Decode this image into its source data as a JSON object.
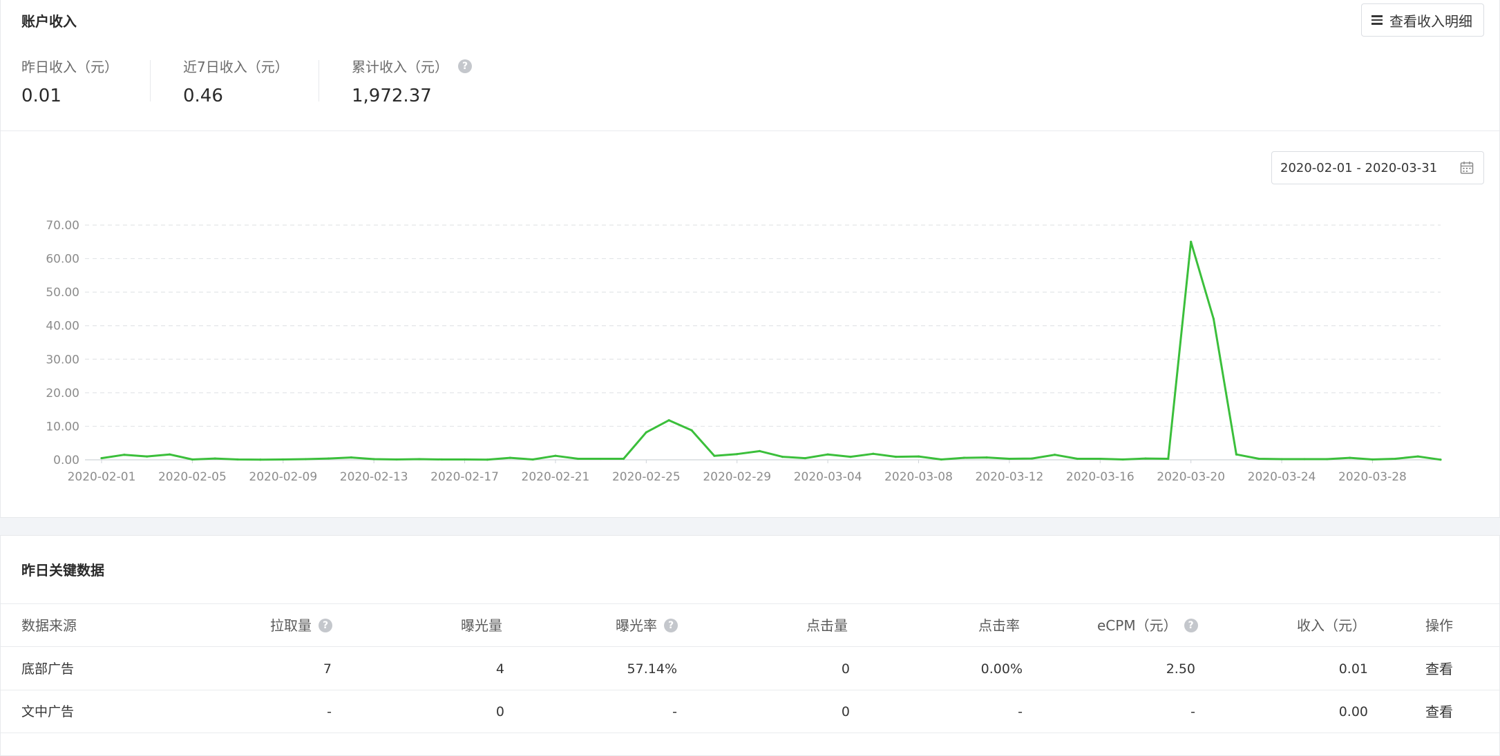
{
  "income": {
    "title": "账户收入",
    "detail_button": "查看收入明细",
    "stats": [
      {
        "label": "昨日收入（元）",
        "value": "0.01"
      },
      {
        "label": "近7日收入（元）",
        "value": "0.46"
      },
      {
        "label": "累计收入（元）",
        "value": "1,972.37"
      }
    ],
    "date_range": "2020-02-01 - 2020-03-31"
  },
  "chart_data": {
    "type": "line",
    "y_ticks": [
      "0.00",
      "10.00",
      "20.00",
      "30.00",
      "40.00",
      "50.00",
      "60.00",
      "70.00"
    ],
    "ylim": [
      0,
      70
    ],
    "x_tick_labels": [
      "2020-02-01",
      "2020-02-05",
      "2020-02-09",
      "2020-02-13",
      "2020-02-17",
      "2020-02-21",
      "2020-02-25",
      "2020-02-29",
      "2020-03-04",
      "2020-03-08",
      "2020-03-12",
      "2020-03-16",
      "2020-03-20",
      "2020-03-24",
      "2020-03-28"
    ],
    "x_start": "2020-02-01",
    "x_end": "2020-03-31",
    "grid": true,
    "color": "#3bbf3b",
    "values": [
      0.5,
      1.5,
      1.0,
      1.6,
      0.1,
      0.4,
      0.1,
      0.05,
      0.1,
      0.2,
      0.4,
      0.7,
      0.2,
      0.1,
      0.2,
      0.1,
      0.1,
      0.05,
      0.6,
      0.1,
      1.2,
      0.3,
      0.3,
      0.3,
      8.2,
      11.8,
      8.8,
      1.2,
      1.7,
      2.6,
      0.9,
      0.5,
      1.6,
      0.9,
      1.8,
      0.9,
      1.0,
      0.1,
      0.6,
      0.7,
      0.3,
      0.4,
      1.5,
      0.3,
      0.3,
      0.1,
      0.4,
      0.3,
      65.0,
      42.0,
      1.6,
      0.3,
      0.2,
      0.2,
      0.2,
      0.6,
      0.1,
      0.3,
      1.0,
      0.05
    ]
  },
  "key_data": {
    "title": "昨日关键数据",
    "columns": [
      "数据来源",
      "拉取量",
      "曝光量",
      "曝光率",
      "点击量",
      "点击率",
      "eCPM（元）",
      "收入（元）",
      "操作"
    ],
    "rows": [
      [
        "底部广告",
        "7",
        "4",
        "57.14%",
        "0",
        "0.00%",
        "2.50",
        "0.01",
        "查看"
      ],
      [
        "文中广告",
        "-",
        "0",
        "-",
        "0",
        "-",
        "-",
        "0.00",
        "查看"
      ]
    ]
  }
}
